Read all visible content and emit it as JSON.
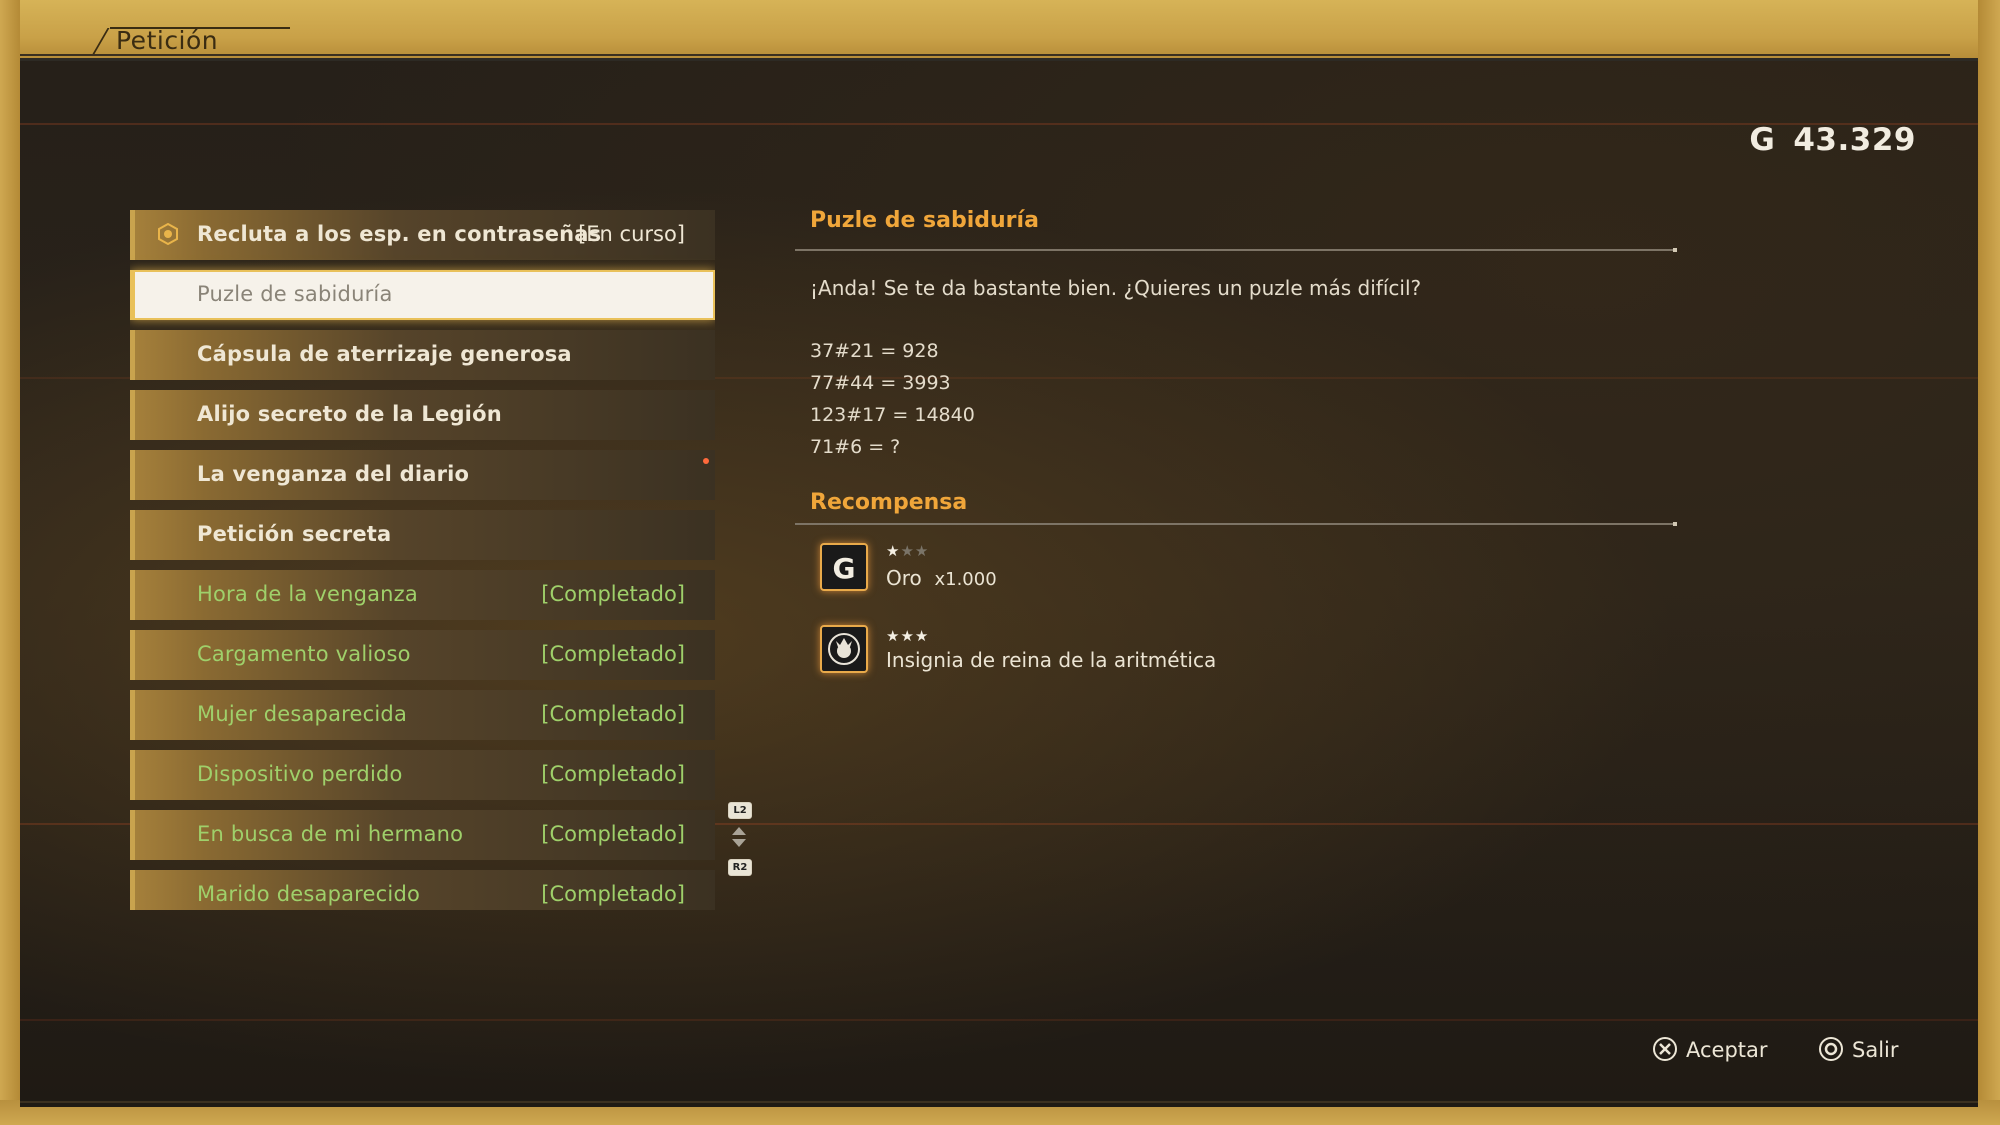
{
  "header": {
    "title": "Petición"
  },
  "gold": {
    "icon": "gold-coin-icon",
    "amount": "43.329"
  },
  "requests": [
    {
      "label": "Recluta a los esp. en contraseñas",
      "status": "[En curso]",
      "state": "active"
    },
    {
      "label": "Puzle de sabiduría",
      "status": "",
      "state": "selected"
    },
    {
      "label": "Cápsula de aterrizaje generosa",
      "status": "",
      "state": "new"
    },
    {
      "label": "Alijo secreto de la Legión",
      "status": "",
      "state": "new"
    },
    {
      "label": "La venganza del diario",
      "status": "",
      "state": "new"
    },
    {
      "label": "Petición secreta",
      "status": "",
      "state": "new"
    },
    {
      "label": "Hora de la venganza",
      "status": "[Completado]",
      "state": "done"
    },
    {
      "label": "Cargamento valioso",
      "status": "[Completado]",
      "state": "done"
    },
    {
      "label": "Mujer desaparecida",
      "status": "[Completado]",
      "state": "done"
    },
    {
      "label": "Dispositivo perdido",
      "status": "[Completado]",
      "state": "done"
    },
    {
      "label": "En busca de mi hermano",
      "status": "[Completado]",
      "state": "done"
    },
    {
      "label": "Marido desaparecido",
      "status": "[Completado]",
      "state": "done"
    }
  ],
  "scroll": {
    "up_button": "L2",
    "down_button": "R2"
  },
  "detail": {
    "title": "Puzle de sabiduría",
    "description": "¡Anda! Se te da bastante bien. ¿Quieres un puzle más difícil?",
    "equations": [
      "37#21 = 928",
      "77#44 = 3993",
      "123#17 = 14840",
      "71#6 = ?"
    ],
    "reward_title": "Recompensa",
    "rewards": [
      {
        "icon": "gold-g-icon",
        "stars_filled": "★",
        "stars_empty": "★★",
        "rating": 1,
        "name": "Oro",
        "quantity": "x1.000"
      },
      {
        "icon": "badge-crown-icon",
        "stars_filled": "★★★",
        "stars_empty": "",
        "rating": 3,
        "name": "Insignia de reina de la aritmética",
        "quantity": ""
      }
    ]
  },
  "controls": {
    "accept": {
      "icon": "cross-button-icon",
      "label": "Aceptar"
    },
    "exit": {
      "icon": "circle-button-icon",
      "label": "Salir"
    }
  },
  "colors": {
    "accent": "#f0a63a",
    "completed": "#9fd06a",
    "frame": "#c9a54a"
  }
}
